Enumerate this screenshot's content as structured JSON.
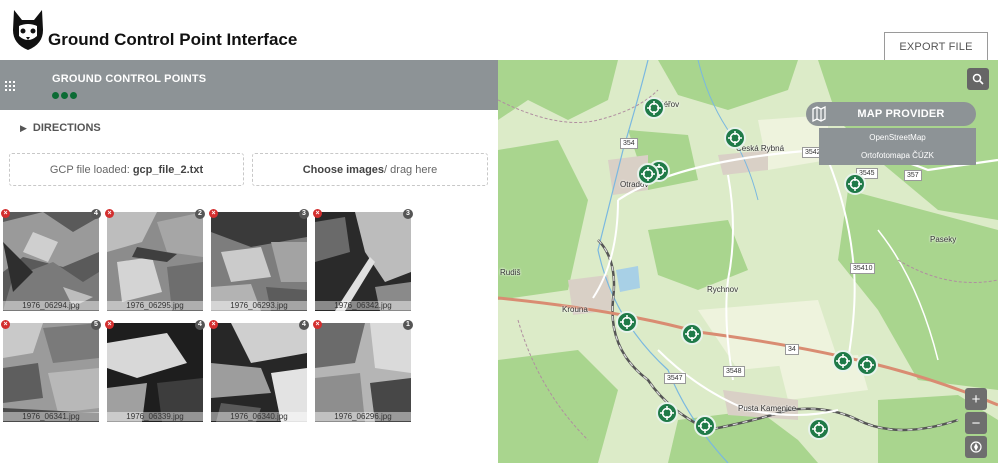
{
  "app": {
    "title": "Ground Control Point Interface",
    "logo_icon": "cat-logo-icon"
  },
  "toolbar": {
    "export_label": "EXPORT FILE"
  },
  "panel": {
    "title": "GROUND CONTROL POINTS",
    "menu_icon": "grid-menu-icon",
    "directions_label": "DIRECTIONS",
    "gcp_file_prefix": "GCP file loaded:",
    "gcp_file_name": "gcp_file_2.txt",
    "choose_images_bold": "Choose images",
    "choose_images_rest": " / drag here"
  },
  "images": [
    {
      "filename": "1976_06294.jpg",
      "count": "4"
    },
    {
      "filename": "1976_06295.jpg",
      "count": "2"
    },
    {
      "filename": "1976_06293.jpg",
      "count": "3"
    },
    {
      "filename": "1976_06342.jpg",
      "count": "3"
    },
    {
      "filename": "1976_06341.jpg",
      "count": "5"
    },
    {
      "filename": "1976_06339.jpg",
      "count": "4"
    },
    {
      "filename": "1976_06340.jpg",
      "count": "4"
    },
    {
      "filename": "1976_06296.jpg",
      "count": "1"
    }
  ],
  "map": {
    "provider_label": "MAP PROVIDER",
    "provider_options": [
      "OpenStreetMap",
      "Ortofotomapa ČÚZK"
    ],
    "zoom_in": "+",
    "zoom_out": "−",
    "places": [
      "Kocléřov",
      "Otradov",
      "Česká Rybná",
      "Krouna",
      "Rychnov",
      "Pusta Kamenice",
      "Paseky",
      "Rudiš"
    ],
    "roads": [
      "354",
      "3542",
      "3545",
      "357",
      "35410",
      "34",
      "3547",
      "3548"
    ],
    "colors": {
      "marker": "#1f7a48",
      "panel_gray": "#8d9396",
      "forest": "#a9d58e",
      "field": "#e7efd6"
    }
  }
}
